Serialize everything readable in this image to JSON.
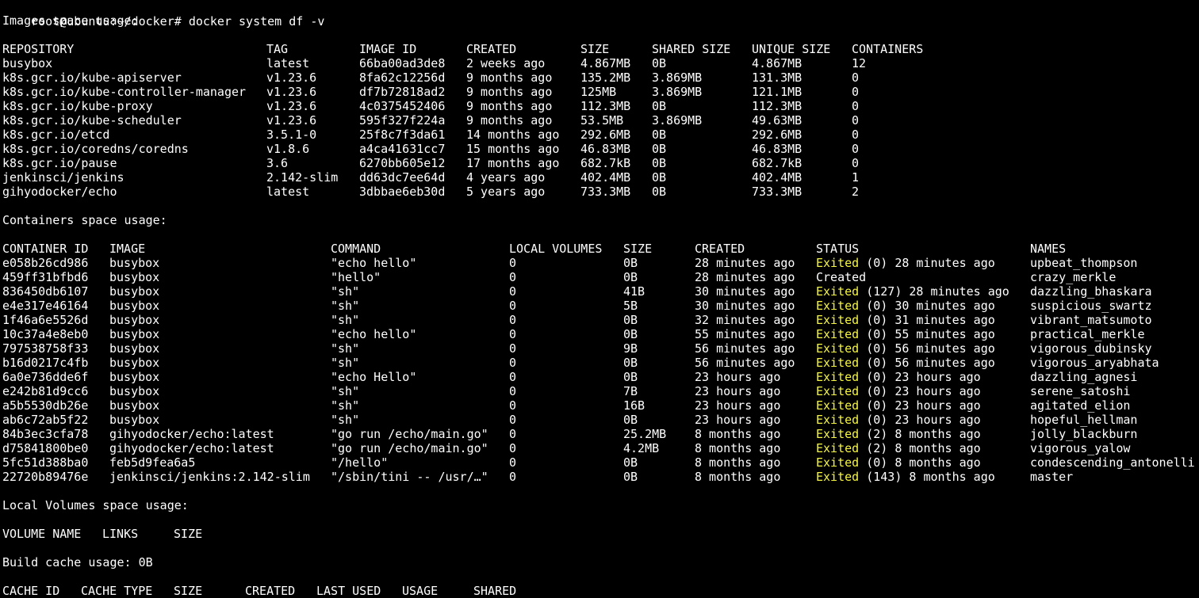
{
  "terminal": {
    "prompt": "root@ubuntu:~/docker#",
    "command": "docker system df -v"
  },
  "colors": {
    "background": "#000000",
    "text": "#ffffff",
    "exited": "#f5f542"
  },
  "images": {
    "title": "Images space usage:",
    "headers": [
      "REPOSITORY",
      "TAG",
      "IMAGE ID",
      "CREATED",
      "SIZE",
      "SHARED SIZE",
      "UNIQUE SIZE",
      "CONTAINERS"
    ],
    "rows": [
      [
        "busybox",
        "latest",
        "66ba00ad3de8",
        "2 weeks ago",
        "4.867MB",
        "0B",
        "4.867MB",
        "12"
      ],
      [
        "k8s.gcr.io/kube-apiserver",
        "v1.23.6",
        "8fa62c12256d",
        "9 months ago",
        "135.2MB",
        "3.869MB",
        "131.3MB",
        "0"
      ],
      [
        "k8s.gcr.io/kube-controller-manager",
        "v1.23.6",
        "df7b72818ad2",
        "9 months ago",
        "125MB",
        "3.869MB",
        "121.1MB",
        "0"
      ],
      [
        "k8s.gcr.io/kube-proxy",
        "v1.23.6",
        "4c0375452406",
        "9 months ago",
        "112.3MB",
        "0B",
        "112.3MB",
        "0"
      ],
      [
        "k8s.gcr.io/kube-scheduler",
        "v1.23.6",
        "595f327f224a",
        "9 months ago",
        "53.5MB",
        "3.869MB",
        "49.63MB",
        "0"
      ],
      [
        "k8s.gcr.io/etcd",
        "3.5.1-0",
        "25f8c7f3da61",
        "14 months ago",
        "292.6MB",
        "0B",
        "292.6MB",
        "0"
      ],
      [
        "k8s.gcr.io/coredns/coredns",
        "v1.8.6",
        "a4ca41631cc7",
        "15 months ago",
        "46.83MB",
        "0B",
        "46.83MB",
        "0"
      ],
      [
        "k8s.gcr.io/pause",
        "3.6",
        "6270bb605e12",
        "17 months ago",
        "682.7kB",
        "0B",
        "682.7kB",
        "0"
      ],
      [
        "jenkinsci/jenkins",
        "2.142-slim",
        "dd63dc7ee64d",
        "4 years ago",
        "402.4MB",
        "0B",
        "402.4MB",
        "1"
      ],
      [
        "gihyodocker/echo",
        "latest",
        "3dbbae6eb30d",
        "5 years ago",
        "733.3MB",
        "0B",
        "733.3MB",
        "2"
      ]
    ]
  },
  "containers": {
    "title": "Containers space usage:",
    "headers": [
      "CONTAINER ID",
      "IMAGE",
      "COMMAND",
      "LOCAL VOLUMES",
      "SIZE",
      "CREATED",
      "STATUS",
      "NAMES"
    ],
    "rows": [
      [
        "e058b26cd986",
        "busybox",
        "\"echo hello\"",
        "0",
        "0B",
        "28 minutes ago",
        "Exited",
        "(0) 28 minutes ago",
        "upbeat_thompson"
      ],
      [
        "459ff31bfbd6",
        "busybox",
        "\"hello\"",
        "0",
        "0B",
        "28 minutes ago",
        "",
        "Created",
        "crazy_merkle"
      ],
      [
        "836450db6107",
        "busybox",
        "\"sh\"",
        "0",
        "41B",
        "30 minutes ago",
        "Exited",
        "(127) 28 minutes ago",
        "dazzling_bhaskara"
      ],
      [
        "e4e317e46164",
        "busybox",
        "\"sh\"",
        "0",
        "5B",
        "30 minutes ago",
        "Exited",
        "(0) 30 minutes ago",
        "suspicious_swartz"
      ],
      [
        "1f46a6e5526d",
        "busybox",
        "\"sh\"",
        "0",
        "0B",
        "32 minutes ago",
        "Exited",
        "(0) 31 minutes ago",
        "vibrant_matsumoto"
      ],
      [
        "10c37a4e8eb0",
        "busybox",
        "\"echo hello\"",
        "0",
        "0B",
        "55 minutes ago",
        "Exited",
        "(0) 55 minutes ago",
        "practical_merkle"
      ],
      [
        "797538758f33",
        "busybox",
        "\"sh\"",
        "0",
        "9B",
        "56 minutes ago",
        "Exited",
        "(0) 56 minutes ago",
        "vigorous_dubinsky"
      ],
      [
        "b16d0217c4fb",
        "busybox",
        "\"sh\"",
        "0",
        "0B",
        "56 minutes ago",
        "Exited",
        "(0) 56 minutes ago",
        "vigorous_aryabhata"
      ],
      [
        "6a0e736dde6f",
        "busybox",
        "\"echo Hello\"",
        "0",
        "0B",
        "23 hours ago",
        "Exited",
        "(0) 23 hours ago",
        "dazzling_agnesi"
      ],
      [
        "e242b81d9cc6",
        "busybox",
        "\"sh\"",
        "0",
        "7B",
        "23 hours ago",
        "Exited",
        "(0) 23 hours ago",
        "serene_satoshi"
      ],
      [
        "a5b5530db26e",
        "busybox",
        "\"sh\"",
        "0",
        "16B",
        "23 hours ago",
        "Exited",
        "(0) 23 hours ago",
        "agitated_elion"
      ],
      [
        "ab6c72ab5f22",
        "busybox",
        "\"sh\"",
        "0",
        "0B",
        "23 hours ago",
        "Exited",
        "(0) 23 hours ago",
        "hopeful_hellman"
      ],
      [
        "84b3ec3cfa78",
        "gihyodocker/echo:latest",
        "\"go run /echo/main.go\"",
        "0",
        "25.2MB",
        "8 months ago",
        "Exited",
        "(2) 8 months ago",
        "jolly_blackburn"
      ],
      [
        "d75841800be0",
        "gihyodocker/echo:latest",
        "\"go run /echo/main.go\"",
        "0",
        "4.2MB",
        "8 months ago",
        "Exited",
        "(2) 8 months ago",
        "vigorous_yalow"
      ],
      [
        "5fc51d388ba0",
        "feb5d9fea6a5",
        "\"/hello\"",
        "0",
        "0B",
        "8 months ago",
        "Exited",
        "(0) 8 months ago",
        "condescending_antonelli"
      ],
      [
        "22720b89476e",
        "jenkinsci/jenkins:2.142-slim",
        "\"/sbin/tini -- /usr/…\"",
        "0",
        "0B",
        "8 months ago",
        "Exited",
        "(143) 8 months ago",
        "master"
      ]
    ]
  },
  "volumes": {
    "title": "Local Volumes space usage:",
    "headers": [
      "VOLUME NAME",
      "LINKS",
      "SIZE"
    ]
  },
  "build_cache": {
    "title": "Build cache usage: 0B",
    "headers": [
      "CACHE ID",
      "CACHE TYPE",
      "SIZE",
      "CREATED",
      "LAST USED",
      "USAGE",
      "SHARED"
    ]
  }
}
